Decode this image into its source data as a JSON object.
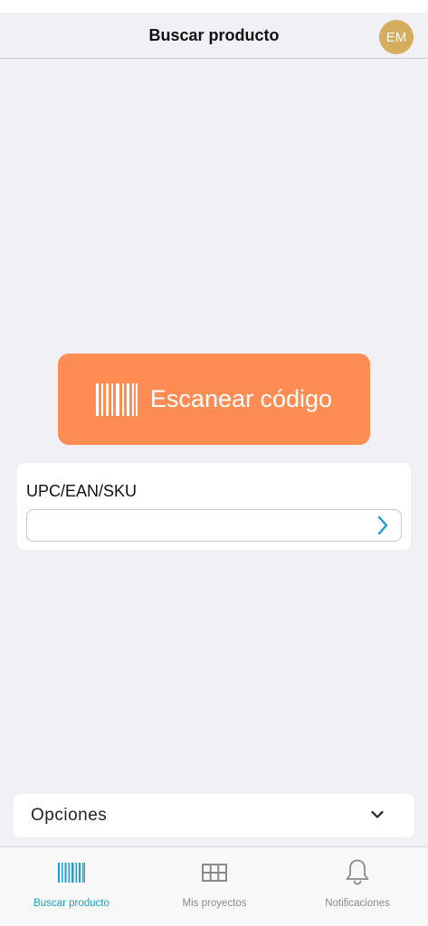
{
  "header": {
    "title": "Buscar producto",
    "avatar_initials": "EM"
  },
  "scan": {
    "label": "Escanear código",
    "icon": "barcode-icon"
  },
  "code_lookup": {
    "label": "UPC/EAN/SKU",
    "value": "",
    "placeholder": "",
    "submit_icon": "chevron-right-icon"
  },
  "options": {
    "label": "Opciones",
    "icon": "chevron-down-icon"
  },
  "tabbar": {
    "items": [
      {
        "label": "Buscar producto",
        "icon": "barcode-icon",
        "active": true
      },
      {
        "label": "Mis proyectos",
        "icon": "grid-icon",
        "active": false
      },
      {
        "label": "Notificaciones",
        "icon": "bell-icon",
        "active": false
      }
    ]
  },
  "colors": {
    "background": "#f1f0f5",
    "scan_button": "#ff8c53",
    "avatar": "#d6ac5f",
    "accent": "#1a9fcf",
    "inactive": "#8a8a8e"
  }
}
